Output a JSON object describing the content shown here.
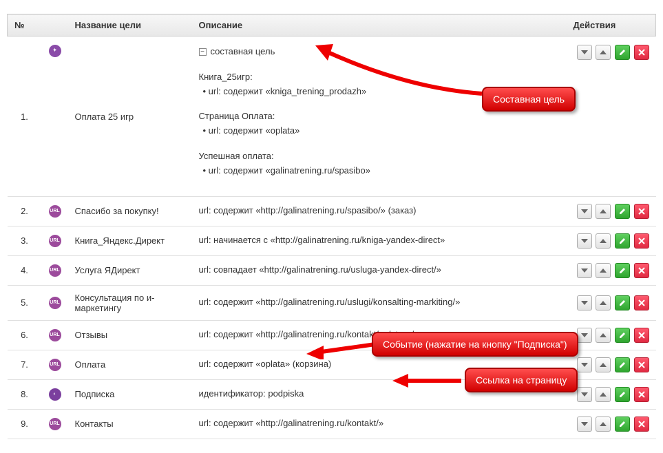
{
  "headers": {
    "num": "№",
    "name": "Название цели",
    "desc": "Описание",
    "actions": "Действия"
  },
  "rows": [
    {
      "num": "1.",
      "icon": "composite",
      "name": "Оплата 25 игр",
      "desc_compound": {
        "top": "составная цель",
        "blocks": [
          {
            "title": "Книга_25игр:",
            "line": "• url: содержит «kniga_trening_prodazh»"
          },
          {
            "title": "Страница Оплата:",
            "line": "• url: содержит «oplata»"
          },
          {
            "title": "Успешная оплата:",
            "line": "• url: содержит «galinatrening.ru/spasibo»"
          }
        ]
      }
    },
    {
      "num": "2.",
      "icon": "url",
      "name": "Спасибо за покупку!",
      "desc": "url: содержит «http://galinatrening.ru/spasibo/» (заказ)"
    },
    {
      "num": "3.",
      "icon": "url",
      "name": "Книга_Яндекс.Директ",
      "desc": "url: начинается с «http://galinatrening.ru/kniga-yandex-direct»"
    },
    {
      "num": "4.",
      "icon": "url",
      "name": "Услуга ЯДирект",
      "desc": "url: совпадает «http://galinatrening.ru/usluga-yandex-direct/»"
    },
    {
      "num": "5.",
      "icon": "url",
      "name": "Консультация по и-маркетингу",
      "desc": "url: содержит «http://galinatrening.ru/uslugi/konsalting-markiting/»"
    },
    {
      "num": "6.",
      "icon": "url",
      "name": "Отзывы",
      "desc": "url: содержит «http://galinatrening.ru/kontakt/ya/otzyv/»"
    },
    {
      "num": "7.",
      "icon": "url",
      "name": "Оплата",
      "desc": "url: содержит «oplata» (корзина)"
    },
    {
      "num": "8.",
      "icon": "event",
      "name": "Подписка",
      "desc": "идентификатор: podpiska"
    },
    {
      "num": "9.",
      "icon": "url",
      "name": "Контакты",
      "desc": "url: содержит «http://galinatrening.ru/kontakt/»"
    }
  ],
  "icon_labels": {
    "url": "URL",
    "composite": "✦",
    "event": "◐"
  },
  "annotations": {
    "a1": "Составная цель",
    "a2": "Событие (нажатие на кнопку \"Подписка\")",
    "a3": "Ссылка на страницу"
  }
}
